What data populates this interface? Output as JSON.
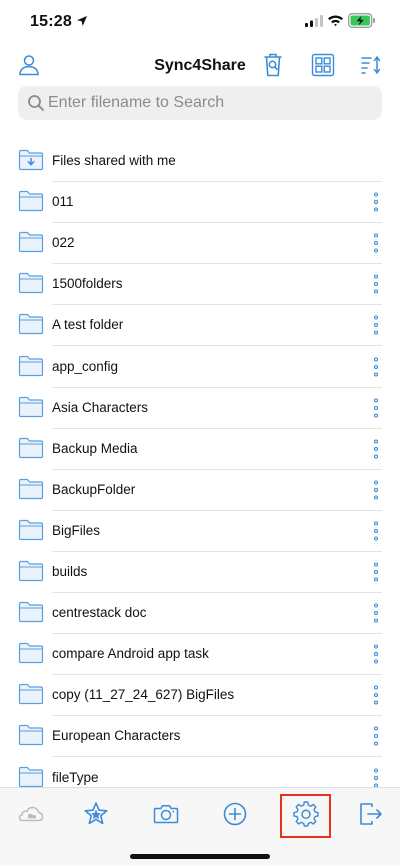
{
  "status_bar": {
    "time": "15:28"
  },
  "header": {
    "title": "Sync4Share"
  },
  "search": {
    "placeholder": "Enter filename to Search",
    "value": ""
  },
  "colors": {
    "accent": "#3b8bd9",
    "folder_fill": "#eaf3fc",
    "folder_stroke": "#5a9fde",
    "highlight": "#e2341f"
  },
  "shared_item": {
    "label": "Files shared with me",
    "icon": "shared-folder-icon"
  },
  "files": [
    {
      "label": "011"
    },
    {
      "label": "022"
    },
    {
      "label": "1500folders"
    },
    {
      "label": "A test folder"
    },
    {
      "label": "app_config"
    },
    {
      "label": "Asia Characters"
    },
    {
      "label": "Backup Media"
    },
    {
      "label": "BackupFolder"
    },
    {
      "label": "BigFiles"
    },
    {
      "label": "builds"
    },
    {
      "label": "centrestack doc"
    },
    {
      "label": "compare Android app task"
    },
    {
      "label": "copy (11_27_24_627) BigFiles"
    },
    {
      "label": "European Characters"
    },
    {
      "label": "fileType"
    }
  ],
  "tab_bar": [
    {
      "icon": "cloud-icon"
    },
    {
      "icon": "favorites-star-icon"
    },
    {
      "icon": "camera-icon"
    },
    {
      "icon": "add-icon"
    },
    {
      "icon": "settings-gear-icon"
    },
    {
      "icon": "logout-icon"
    }
  ]
}
